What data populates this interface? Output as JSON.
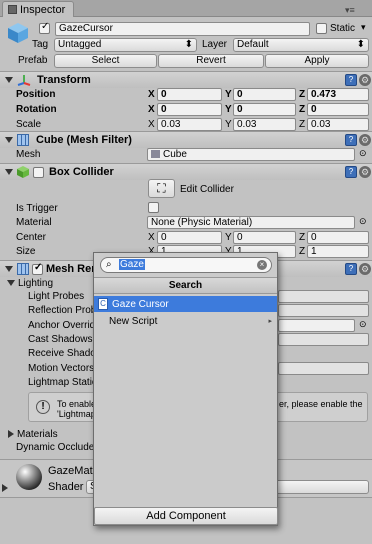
{
  "tab": {
    "label": "Inspector"
  },
  "object": {
    "name": "GazeCursor",
    "static_label": "Static",
    "tag_label": "Tag",
    "tag_value": "Untagged",
    "layer_label": "Layer",
    "layer_value": "Default",
    "prefab_label": "Prefab",
    "select_label": "Select",
    "revert_label": "Revert",
    "apply_label": "Apply"
  },
  "transform": {
    "title": "Transform",
    "position_label": "Position",
    "rotation_label": "Rotation",
    "scale_label": "Scale",
    "position": {
      "x": "0",
      "y": "0",
      "z": "0.473"
    },
    "rotation": {
      "x": "0",
      "y": "0",
      "z": "0"
    },
    "scale": {
      "x": "0.03",
      "y": "0.03",
      "z": "0.03"
    }
  },
  "mesh_filter": {
    "title": "Cube (Mesh Filter)",
    "mesh_label": "Mesh",
    "mesh_value": "Cube"
  },
  "box_collider": {
    "title": "Box Collider",
    "edit_label": "Edit Collider",
    "is_trigger_label": "Is Trigger",
    "material_label": "Material",
    "material_value": "None (Physic Material)",
    "center_label": "Center",
    "size_label": "Size",
    "center": {
      "x": "0",
      "y": "0",
      "z": "0"
    },
    "size": {
      "x": "1",
      "y": "1",
      "z": "1"
    }
  },
  "mesh_renderer": {
    "title": "Mesh Renderer",
    "lighting_label": "Lighting",
    "items": [
      "Light Probes",
      "Reflection Probes",
      "Anchor Override",
      "Cast Shadows",
      "Receive Shadows",
      "Motion Vectors",
      "Lightmap Static"
    ],
    "info_text_left": "To enable",
    "info_text_right": "er, please enable the",
    "info_text_line2": "'Lightmap",
    "materials_label": "Materials",
    "dynamic_occluder_label": "Dynamic Occluder"
  },
  "material": {
    "name": "GazeMaterial",
    "shader_label": "Shader",
    "shader_value": "S"
  },
  "add_component": {
    "label": "Add Component"
  },
  "search_popup": {
    "query": "Gaze",
    "header": "Search",
    "results": [
      {
        "label": "Gaze Cursor",
        "selected": true
      },
      {
        "label": "New Script",
        "selected": false
      }
    ]
  },
  "colors": {
    "selection": "#3d7bdc",
    "help_icon": "#3e6fb8",
    "panel": "#c2c2c2"
  }
}
